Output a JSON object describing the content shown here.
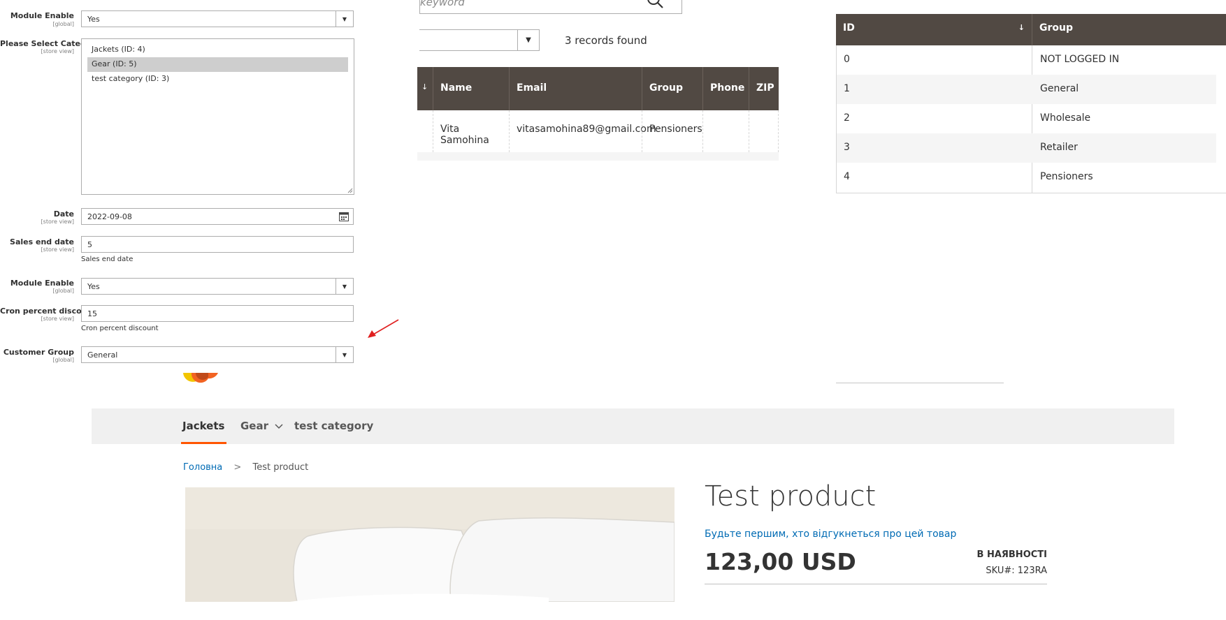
{
  "admin_form": {
    "module_enable_1": {
      "label": "Module Enable",
      "scope": "[global]",
      "value": "Yes"
    },
    "category": {
      "label": "Please Select Category",
      "scope": "[store view]",
      "options": [
        "Jackets (ID: 4)",
        "Gear (ID: 5)",
        "test category (ID: 3)"
      ],
      "selected_index": 1
    },
    "date": {
      "label": "Date",
      "scope": "[store view]",
      "value": "2022-09-08"
    },
    "sales_end_date": {
      "label": "Sales end date",
      "scope": "[store view]",
      "value": "5",
      "note": "Sales end date"
    },
    "module_enable_2": {
      "label": "Module Enable",
      "scope": "[global]",
      "value": "Yes"
    },
    "cron_discount": {
      "label": "Cron percent discount",
      "scope": "[store view]",
      "value": "15",
      "note": "Cron percent discount"
    },
    "customer_group": {
      "label": "Customer Group",
      "scope": "[global]",
      "value": "General"
    }
  },
  "grid": {
    "search_placeholder": "keyword",
    "records_found": "3 records found",
    "sort_arrow": "↓",
    "columns": [
      "Name",
      "Email",
      "Group",
      "Phone",
      "ZIP"
    ],
    "rows": [
      {
        "name": "Vita Samohina",
        "email": "vitasamohina89@gmail.com",
        "group": "Pensioners",
        "phone": "",
        "zip": ""
      }
    ]
  },
  "groups_table": {
    "columns": [
      "ID",
      "Group"
    ],
    "sort_arrow": "↓",
    "rows": [
      {
        "id": "0",
        "group": "NOT LOGGED IN"
      },
      {
        "id": "1",
        "group": "General"
      },
      {
        "id": "2",
        "group": "Wholesale"
      },
      {
        "id": "3",
        "group": "Retailer"
      },
      {
        "id": "4",
        "group": "Pensioners"
      }
    ]
  },
  "storefront": {
    "nav": [
      "Jackets",
      "Gear",
      "test category"
    ],
    "breadcrumb": {
      "home": "Головна",
      "separator": ">",
      "current": "Test product"
    },
    "product": {
      "title": "Test product",
      "review_link": "Будьте першим, хто відгукнеться про цей товар",
      "price": "123,00 USD",
      "stock": "В НАЯВНОСТІ",
      "sku_label": "SKU#:",
      "sku": "123RA"
    }
  },
  "colors": {
    "grid_header": "#514943",
    "annotation_arrow": "#e02020",
    "nav_active": "#ff5501",
    "link": "#006bb4"
  }
}
